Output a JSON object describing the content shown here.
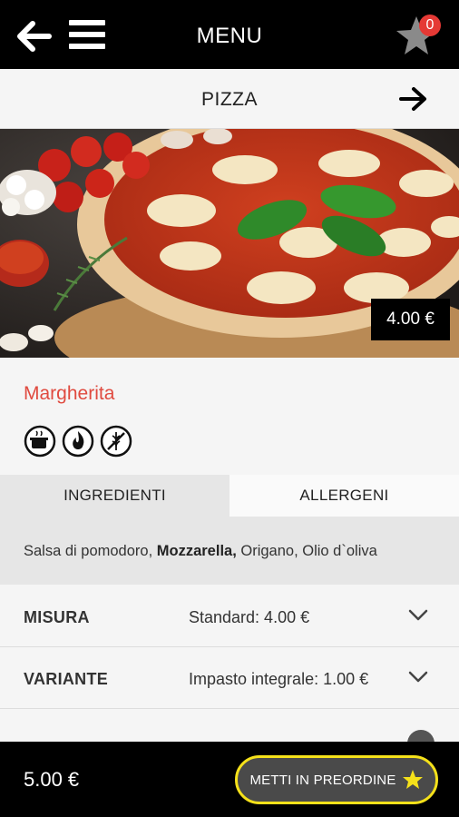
{
  "topbar": {
    "title": "MENU",
    "cart_count": "0",
    "back_icon": "back-arrow-icon",
    "menu_icon": "hamburger-icon",
    "cart_icon": "star-cart-icon"
  },
  "category": {
    "name": "PIZZA",
    "next_icon": "arrow-right-icon"
  },
  "product": {
    "price": "4.00 €",
    "name": "Margherita",
    "diet_icons": [
      "cooking-pot-icon",
      "spicy-flame-icon",
      "no-gluten-icon"
    ]
  },
  "tabs": [
    {
      "label": "INGREDIENTI"
    },
    {
      "label": "ALLERGENI"
    }
  ],
  "ingredients": {
    "part1": "Salsa di pomodoro, ",
    "bold": "Mozzarella,",
    "part2": " Origano, Olio d`oliva"
  },
  "options": [
    {
      "label": "MISURA",
      "value": "Standard: 4.00 €"
    },
    {
      "label": "VARIANTE",
      "value": "Impasto integrale: 1.00 €"
    }
  ],
  "footer": {
    "total": "5.00 €",
    "preorder_label": "METTI IN PREORDINE"
  },
  "colors": {
    "accent_red": "#e04a3f",
    "button_border": "#f5e11a",
    "badge": "#e53935"
  }
}
